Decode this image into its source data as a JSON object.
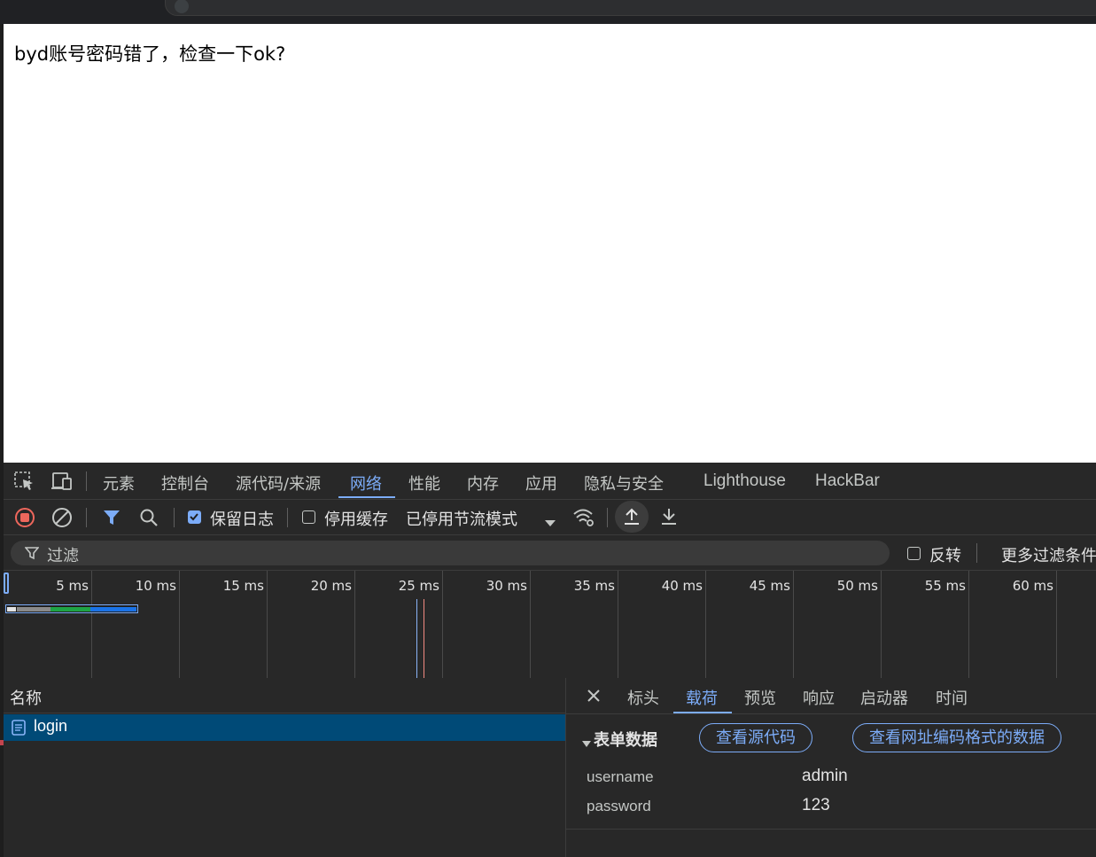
{
  "page": {
    "message": "byd账号密码错了，检查一下ok?"
  },
  "devtools": {
    "tabs": [
      "元素",
      "控制台",
      "源代码/来源",
      "网络",
      "性能",
      "内存",
      "应用",
      "隐私与安全",
      "Lighthouse",
      "HackBar"
    ],
    "active_tab": "网络",
    "toolbar": {
      "preserve_log": "保留日志",
      "disable_cache": "停用缓存",
      "throttling": "已停用节流模式"
    },
    "filter": {
      "placeholder": "过滤",
      "invert": "反转",
      "more": "更多过滤条件"
    },
    "timeline_ticks": [
      "5 ms",
      "10 ms",
      "15 ms",
      "20 ms",
      "25 ms",
      "30 ms",
      "35 ms",
      "40 ms",
      "45 ms",
      "50 ms",
      "55 ms",
      "60 ms"
    ],
    "requests": {
      "column_name": "名称",
      "items": [
        {
          "name": "login",
          "selected": true
        }
      ]
    },
    "detail": {
      "tabs": [
        "标头",
        "载荷",
        "预览",
        "响应",
        "启动器",
        "时间"
      ],
      "active_tab": "载荷",
      "section_title": "表单数据",
      "view_source": "查看源代码",
      "view_url_encoded": "查看网址编码格式的数据",
      "form_fields": [
        {
          "key": "username",
          "value": "admin"
        },
        {
          "key": "password",
          "value": "123"
        }
      ]
    },
    "colors": {
      "accent": "#7cacf8",
      "selected_row": "#004a77",
      "record_stop": "#ee675c"
    }
  }
}
